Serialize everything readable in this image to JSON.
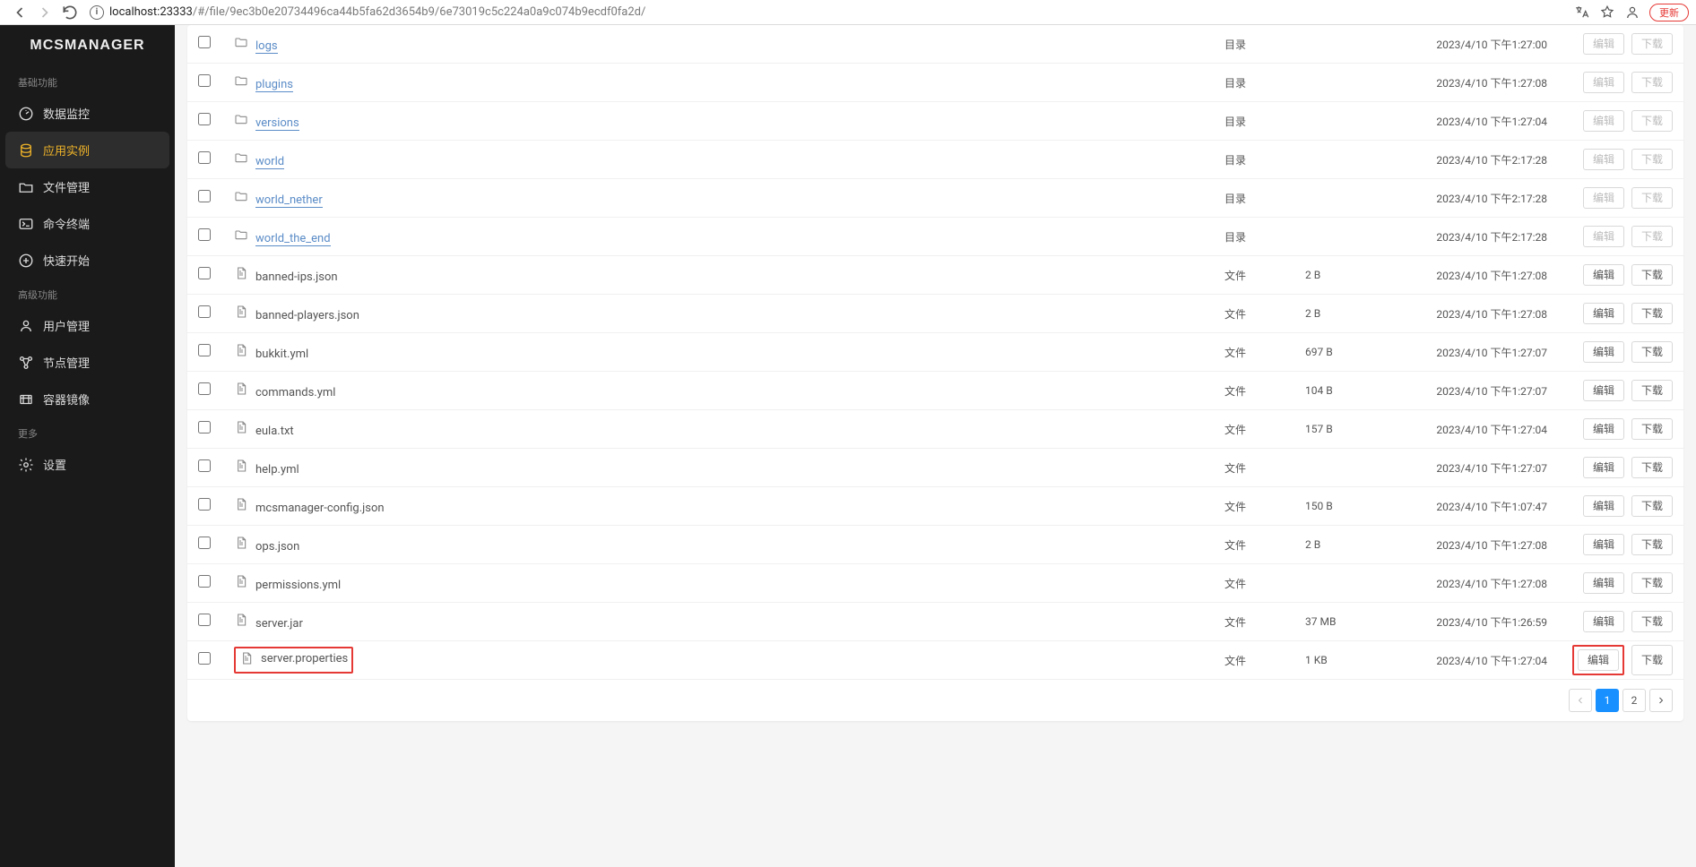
{
  "browser": {
    "url_host": "localhost:",
    "url_port": "23333",
    "url_path": "/#/file/9ec3b0e20734496ca44b5fa62d3654b9/6e73019c5c224a0a9c074b9ecdf0fa2d/",
    "update_btn": "更新"
  },
  "app_name": "MCSMANAGER",
  "sidebar": {
    "sec_basic": "基础功能",
    "sec_adv": "高级功能",
    "sec_more": "更多",
    "items": {
      "data_monitor": "数据监控",
      "app_instance": "应用实例",
      "file_mgmt": "文件管理",
      "command_terminal": "命令终端",
      "quick_start": "快速开始",
      "user_mgmt": "用户管理",
      "node_mgmt": "节点管理",
      "container_image": "容器镜像",
      "settings": "设置"
    }
  },
  "labels": {
    "dir_type": "目录",
    "file_type": "文件",
    "edit": "编辑",
    "download": "下载"
  },
  "rows": [
    {
      "name": "logs",
      "kind": "dir",
      "type": "目录",
      "size": "",
      "mtime": "2023/4/10 下午1:27:00"
    },
    {
      "name": "plugins",
      "kind": "dir",
      "type": "目录",
      "size": "",
      "mtime": "2023/4/10 下午1:27:08"
    },
    {
      "name": "versions",
      "kind": "dir",
      "type": "目录",
      "size": "",
      "mtime": "2023/4/10 下午1:27:04"
    },
    {
      "name": "world",
      "kind": "dir",
      "type": "目录",
      "size": "",
      "mtime": "2023/4/10 下午2:17:28"
    },
    {
      "name": "world_nether",
      "kind": "dir",
      "type": "目录",
      "size": "",
      "mtime": "2023/4/10 下午2:17:28"
    },
    {
      "name": "world_the_end",
      "kind": "dir",
      "type": "目录",
      "size": "",
      "mtime": "2023/4/10 下午2:17:28"
    },
    {
      "name": "banned-ips.json",
      "kind": "file",
      "type": "文件",
      "size": "2 B",
      "mtime": "2023/4/10 下午1:27:08"
    },
    {
      "name": "banned-players.json",
      "kind": "file",
      "type": "文件",
      "size": "2 B",
      "mtime": "2023/4/10 下午1:27:08"
    },
    {
      "name": "bukkit.yml",
      "kind": "file",
      "type": "文件",
      "size": "697 B",
      "mtime": "2023/4/10 下午1:27:07"
    },
    {
      "name": "commands.yml",
      "kind": "file",
      "type": "文件",
      "size": "104 B",
      "mtime": "2023/4/10 下午1:27:07"
    },
    {
      "name": "eula.txt",
      "kind": "file",
      "type": "文件",
      "size": "157 B",
      "mtime": "2023/4/10 下午1:27:04"
    },
    {
      "name": "help.yml",
      "kind": "file",
      "type": "文件",
      "size": "",
      "mtime": "2023/4/10 下午1:27:07"
    },
    {
      "name": "mcsmanager-config.json",
      "kind": "file",
      "type": "文件",
      "size": "150 B",
      "mtime": "2023/4/10 下午1:07:47"
    },
    {
      "name": "ops.json",
      "kind": "file",
      "type": "文件",
      "size": "2 B",
      "mtime": "2023/4/10 下午1:27:08"
    },
    {
      "name": "permissions.yml",
      "kind": "file",
      "type": "文件",
      "size": "",
      "mtime": "2023/4/10 下午1:27:08"
    },
    {
      "name": "server.jar",
      "kind": "file",
      "type": "文件",
      "size": "37 MB",
      "mtime": "2023/4/10 下午1:26:59"
    },
    {
      "name": "server.properties",
      "kind": "file",
      "type": "文件",
      "size": "1 KB",
      "mtime": "2023/4/10 下午1:27:04",
      "highlight": true
    }
  ],
  "pagination": {
    "current": "1",
    "pages": [
      "1",
      "2"
    ]
  }
}
